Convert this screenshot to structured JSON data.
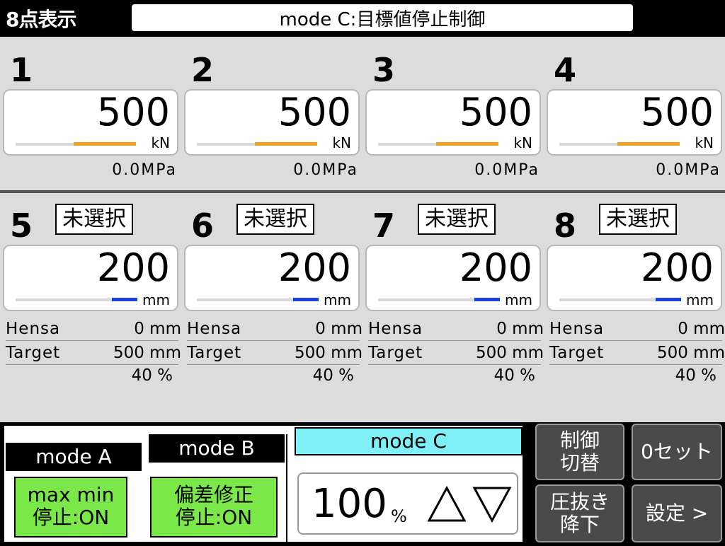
{
  "header": {
    "title": "8点表示",
    "mode": "mode C:目標値停止制御"
  },
  "load_channels": [
    {
      "num": "1",
      "value": "500",
      "unit": "kN",
      "pressure": "0.0MPa",
      "bar_color": "#f0a020"
    },
    {
      "num": "2",
      "value": "500",
      "unit": "kN",
      "pressure": "0.0MPa",
      "bar_color": "#f0a020"
    },
    {
      "num": "3",
      "value": "500",
      "unit": "kN",
      "pressure": "0.0MPa",
      "bar_color": "#f0a020"
    },
    {
      "num": "4",
      "value": "500",
      "unit": "kN",
      "pressure": "0.0MPa",
      "bar_color": "#f0a020"
    }
  ],
  "disp_channels": [
    {
      "num": "5",
      "badge": "未選択",
      "value": "200",
      "unit": "mm",
      "hensa_label": "Hensa",
      "hensa": "0 mm",
      "target_label": "Target",
      "target": "500 mm",
      "percent": "40 %",
      "bar_color": "#1f3fe0"
    },
    {
      "num": "6",
      "badge": "未選択",
      "value": "200",
      "unit": "mm",
      "hensa_label": "Hensa",
      "hensa": "0 mm",
      "target_label": "Target",
      "target": "500 mm",
      "percent": "40 %",
      "bar_color": "#1f3fe0"
    },
    {
      "num": "7",
      "badge": "未選択",
      "value": "200",
      "unit": "mm",
      "hensa_label": "Hensa",
      "hensa": "0 mm",
      "target_label": "Target",
      "target": "500 mm",
      "percent": "40 %",
      "bar_color": "#1f3fe0"
    },
    {
      "num": "8",
      "badge": "未選択",
      "value": "200",
      "unit": "mm",
      "hensa_label": "Hensa",
      "hensa": "0 mm",
      "target_label": "Target",
      "target": "500 mm",
      "percent": "40 %",
      "bar_color": "#1f3fe0"
    }
  ],
  "modes": {
    "a": {
      "tab": "mode A",
      "line1": "max min",
      "line2": "停止:ON"
    },
    "b": {
      "tab": "mode B",
      "line1": "偏差修正",
      "line2": "停止:ON"
    },
    "c": {
      "tab": "mode C",
      "value": "100",
      "unit": "%",
      "up_icon": "up-triangle-icon",
      "down_icon": "down-triangle-icon"
    }
  },
  "side_buttons": {
    "control_switch": [
      "制御",
      "切替"
    ],
    "zero_set": "0セット",
    "pressure_release": [
      "圧抜き",
      "降下"
    ],
    "settings": "設定 >"
  },
  "colors": {
    "active_mode_tab": "#7ff0f6",
    "mode_button_green": "#7be84a",
    "load_bar": "#f0a020",
    "disp_bar": "#1f3fe0"
  }
}
